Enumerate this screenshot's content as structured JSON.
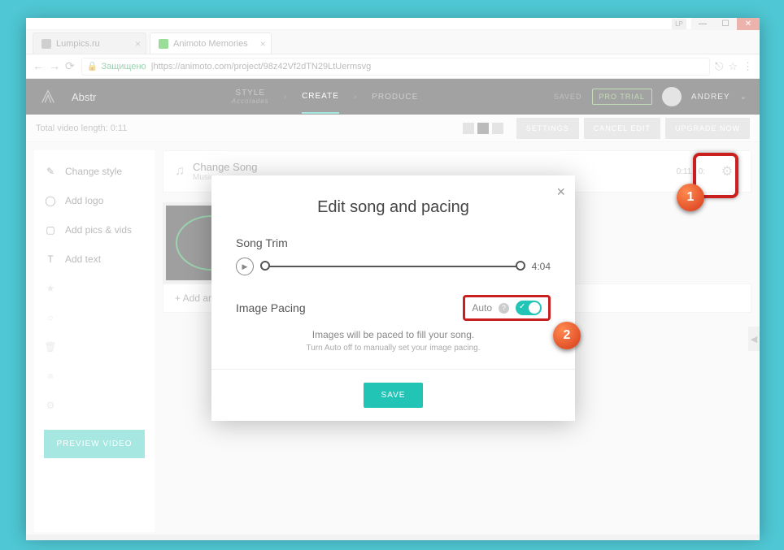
{
  "window": {
    "lp_badge": "LP"
  },
  "tabs": [
    {
      "title": "Lumpics.ru"
    },
    {
      "title": "Animoto Memories"
    }
  ],
  "urlbar": {
    "secure": "Защищено",
    "url": "https://animoto.com/project/98z42Vf2dTN29LtUermsvg"
  },
  "header": {
    "project": "Abstr",
    "steps": {
      "style": "STYLE",
      "style_sub": "Accolades",
      "create": "CREATE",
      "produce": "PRODUCE"
    },
    "saved": "SAVED",
    "pro_trial": "PRO TRIAL",
    "username": "ANDREY"
  },
  "toolbar": {
    "length_label": "Total video length: 0:11",
    "settings": "SETTINGS",
    "cancel": "CANCEL EDIT",
    "upgrade": "UPGRADE NOW"
  },
  "sidebar": {
    "change_style": "Change style",
    "add_logo": "Add logo",
    "add_pics": "Add pics & vids",
    "add_text": "Add text",
    "disabled": [
      "",
      "",
      "",
      "",
      ""
    ],
    "preview": "PREVIEW VIDEO"
  },
  "song_card": {
    "title": "Change Song",
    "sub": "Music · ",
    "time": "0:11 / 0:"
  },
  "add_another": "+ Add another s",
  "modal": {
    "title": "Edit song and pacing",
    "song_trim": "Song Trim",
    "trim_time": "4:04",
    "image_pacing": "Image Pacing",
    "auto": "Auto",
    "desc": "Images will be paced to fill your song.",
    "hint": "Turn Auto off to manually set your image pacing.",
    "save": "SAVE"
  },
  "callouts": {
    "n1": "1",
    "n2": "2"
  }
}
